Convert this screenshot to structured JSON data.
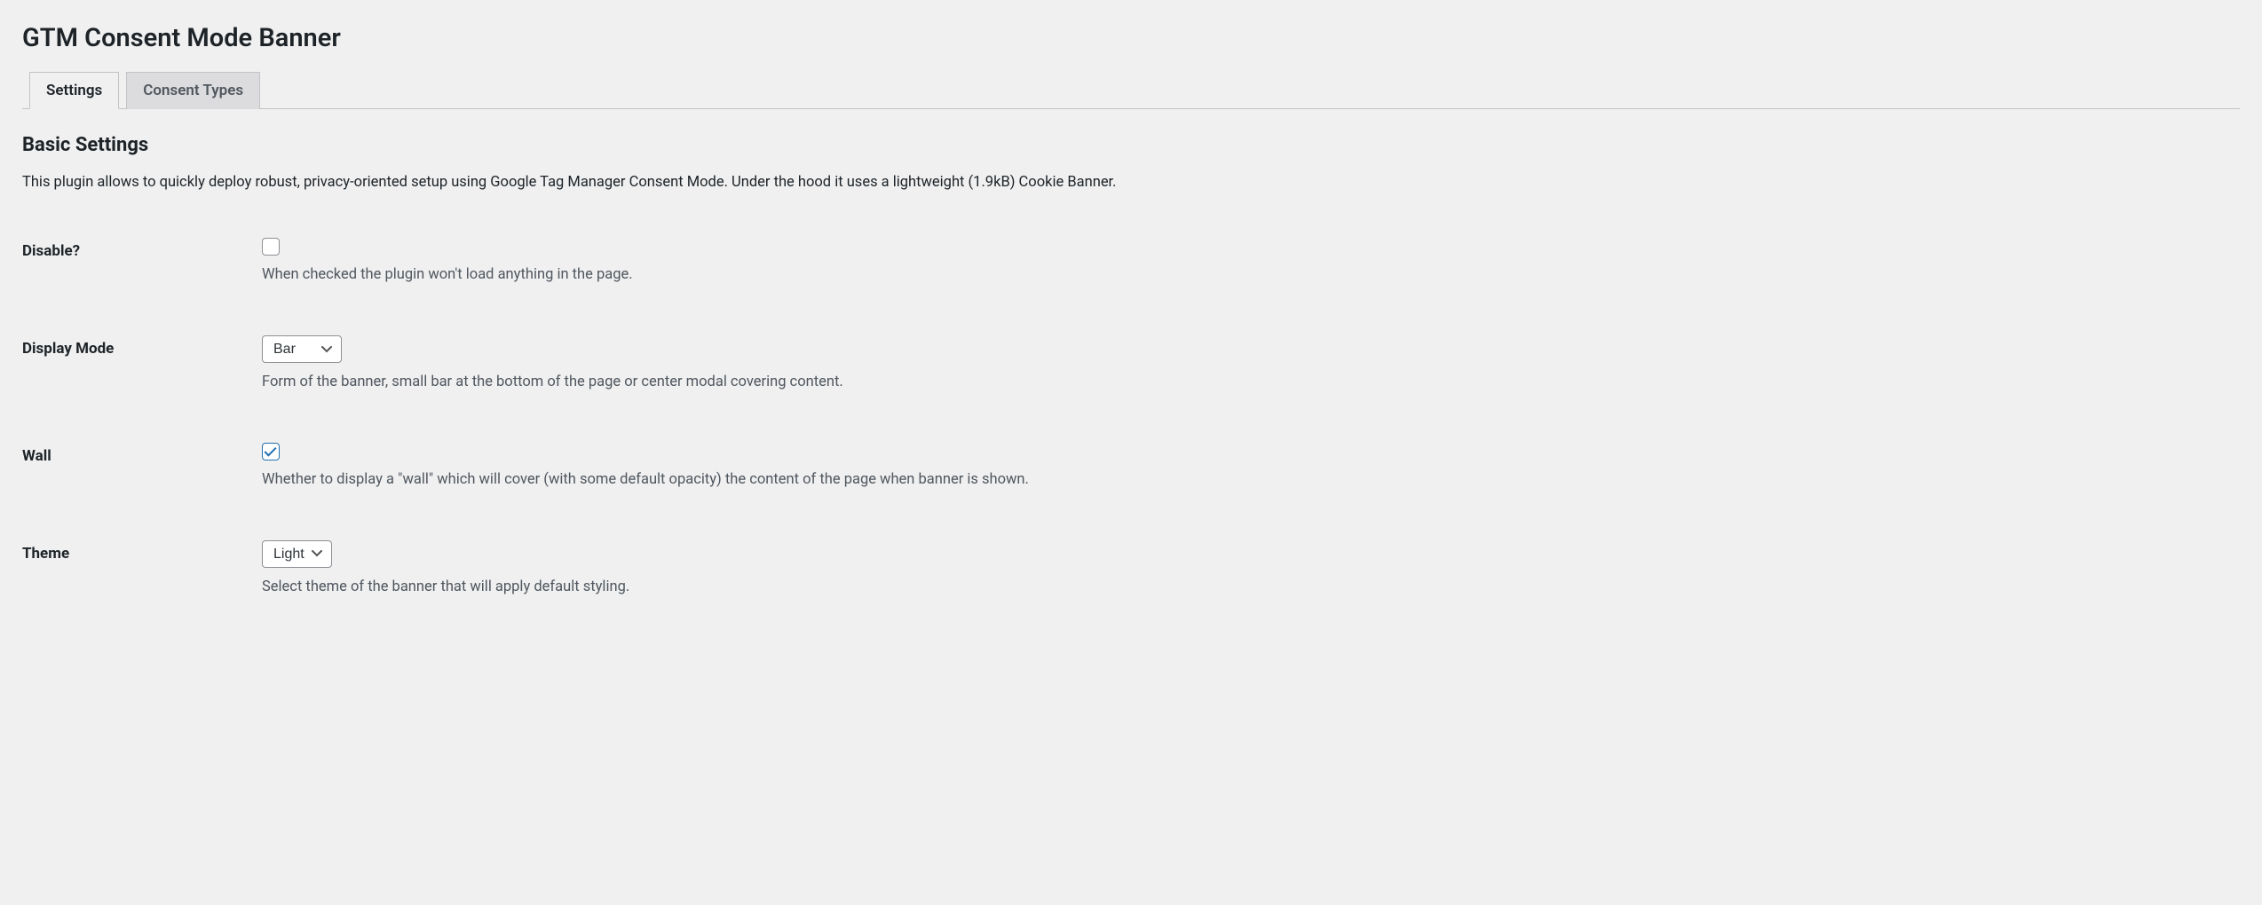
{
  "header": {
    "title": "GTM Consent Mode Banner"
  },
  "tabs": [
    {
      "label": "Settings",
      "active": true
    },
    {
      "label": "Consent Types",
      "active": false
    }
  ],
  "section": {
    "title": "Basic Settings",
    "intro": "This plugin allows to quickly deploy robust, privacy-oriented setup using Google Tag Manager Consent Mode. Under the hood it uses a lightweight (1.9kB) Cookie Banner."
  },
  "fields": {
    "disable": {
      "label": "Disable?",
      "checked": false,
      "description": "When checked the plugin won't load anything in the page."
    },
    "display_mode": {
      "label": "Display Mode",
      "value": "Bar",
      "description": "Form of the banner, small bar at the bottom of the page or center modal covering content."
    },
    "wall": {
      "label": "Wall",
      "checked": true,
      "description": "Whether to display a \"wall\" which will cover (with some default opacity) the content of the page when banner is shown."
    },
    "theme": {
      "label": "Theme",
      "value": "Light",
      "description": "Select theme of the banner that will apply default styling."
    }
  }
}
